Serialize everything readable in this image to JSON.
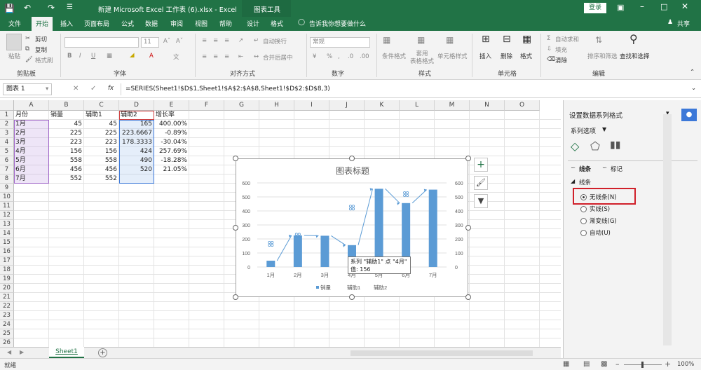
{
  "titlebar": {
    "title": "新建 Microsoft Excel 工作表 (6).xlsx - Excel",
    "chart_tools": "图表工具",
    "login": "登录"
  },
  "tabs": {
    "file": "文件",
    "home": "开始",
    "insert": "插入",
    "page_layout": "页面布局",
    "formulas": "公式",
    "data": "数据",
    "review": "审阅",
    "view": "视图",
    "help": "帮助",
    "design": "设计",
    "format": "格式",
    "tell_me": "告诉我你想要做什么",
    "share": "共享"
  },
  "ribbon": {
    "clipboard": {
      "paste": "粘贴",
      "cut": "剪切",
      "copy": "复制",
      "format_painter": "格式刷",
      "label": "剪贴板"
    },
    "font": {
      "size": "11",
      "bold": "B",
      "italic": "I",
      "underline": "U",
      "label": "字体"
    },
    "alignment": {
      "wrap": "自动换行",
      "merge": "合并后居中",
      "label": "对齐方式"
    },
    "number": {
      "format": "常规",
      "label": "数字"
    },
    "styles": {
      "cond": "条件格式",
      "table": "套用\n表格格式",
      "cell": "单元格样式",
      "label": "样式"
    },
    "cells": {
      "insert": "插入",
      "delete": "删除",
      "format": "格式",
      "label": "单元格"
    },
    "editing": {
      "autosum": "自动求和",
      "fill": "填充",
      "clear": "清除",
      "sort": "排序和筛选",
      "find": "查找和选择",
      "label": "编辑"
    }
  },
  "formula_bar": {
    "name_box": "图表 1",
    "fx": "fx",
    "formula": "=SERIES(Sheet1!$D$1,Sheet1!$A$2:$A$8,Sheet1!$D$2:$D$8,3)"
  },
  "columns": [
    "A",
    "B",
    "C",
    "D",
    "E",
    "F",
    "G",
    "H",
    "I",
    "J",
    "K",
    "L",
    "M",
    "N",
    "O"
  ],
  "rows": [
    "1",
    "2",
    "3",
    "4",
    "5",
    "6",
    "7",
    "8",
    "9",
    "10",
    "11",
    "12",
    "13",
    "14",
    "15",
    "16",
    "17",
    "18",
    "19",
    "20",
    "21",
    "22",
    "23",
    "24",
    "25",
    "26"
  ],
  "table": {
    "headers": [
      "月份",
      "销量",
      "辅助1",
      "辅助2",
      "增长率"
    ],
    "rows": [
      [
        "1月",
        "45",
        "45",
        "165",
        "400.00%"
      ],
      [
        "2月",
        "225",
        "225",
        "223.6667",
        "-0.89%"
      ],
      [
        "3月",
        "223",
        "223",
        "178.3333",
        "-30.04%"
      ],
      [
        "4月",
        "156",
        "156",
        "424",
        "257.69%"
      ],
      [
        "5月",
        "558",
        "558",
        "490",
        "-18.28%"
      ],
      [
        "6月",
        "456",
        "456",
        "520",
        "21.05%"
      ],
      [
        "7月",
        "552",
        "552",
        "",
        ""
      ]
    ]
  },
  "chart_data": {
    "type": "bar",
    "title": "图表标题",
    "categories": [
      "1月",
      "2月",
      "3月",
      "4月",
      "5月",
      "6月",
      "7月"
    ],
    "series": [
      {
        "name": "销量",
        "values": [
          45,
          225,
          223,
          156,
          558,
          456,
          552
        ]
      },
      {
        "name": "辅助1",
        "values": [
          45,
          225,
          223,
          156,
          558,
          456,
          552
        ]
      },
      {
        "name": "辅助2",
        "values": [
          165,
          223.6667,
          178.3333,
          424,
          490,
          520
        ]
      }
    ],
    "ylim": [
      0,
      600
    ],
    "yticks": [
      "0",
      "100",
      "200",
      "300",
      "400",
      "500",
      "600"
    ],
    "tooltip": {
      "line1": "系列 \"辅助1\" 点 \"4月\"",
      "line2": "值: 156"
    },
    "bar_color": "#5b9bd5"
  },
  "pane": {
    "title": "设置数据系列格式",
    "series_options": "系列选项",
    "tab_line": "线条",
    "tab_marker": "标记",
    "section": "线条",
    "options": [
      "无线条(N)",
      "实线(S)",
      "渐变线(G)",
      "自动(U)"
    ]
  },
  "sheet": {
    "name": "Sheet1",
    "add": "+"
  },
  "status": {
    "ready": "就绪",
    "zoom": "100%"
  }
}
